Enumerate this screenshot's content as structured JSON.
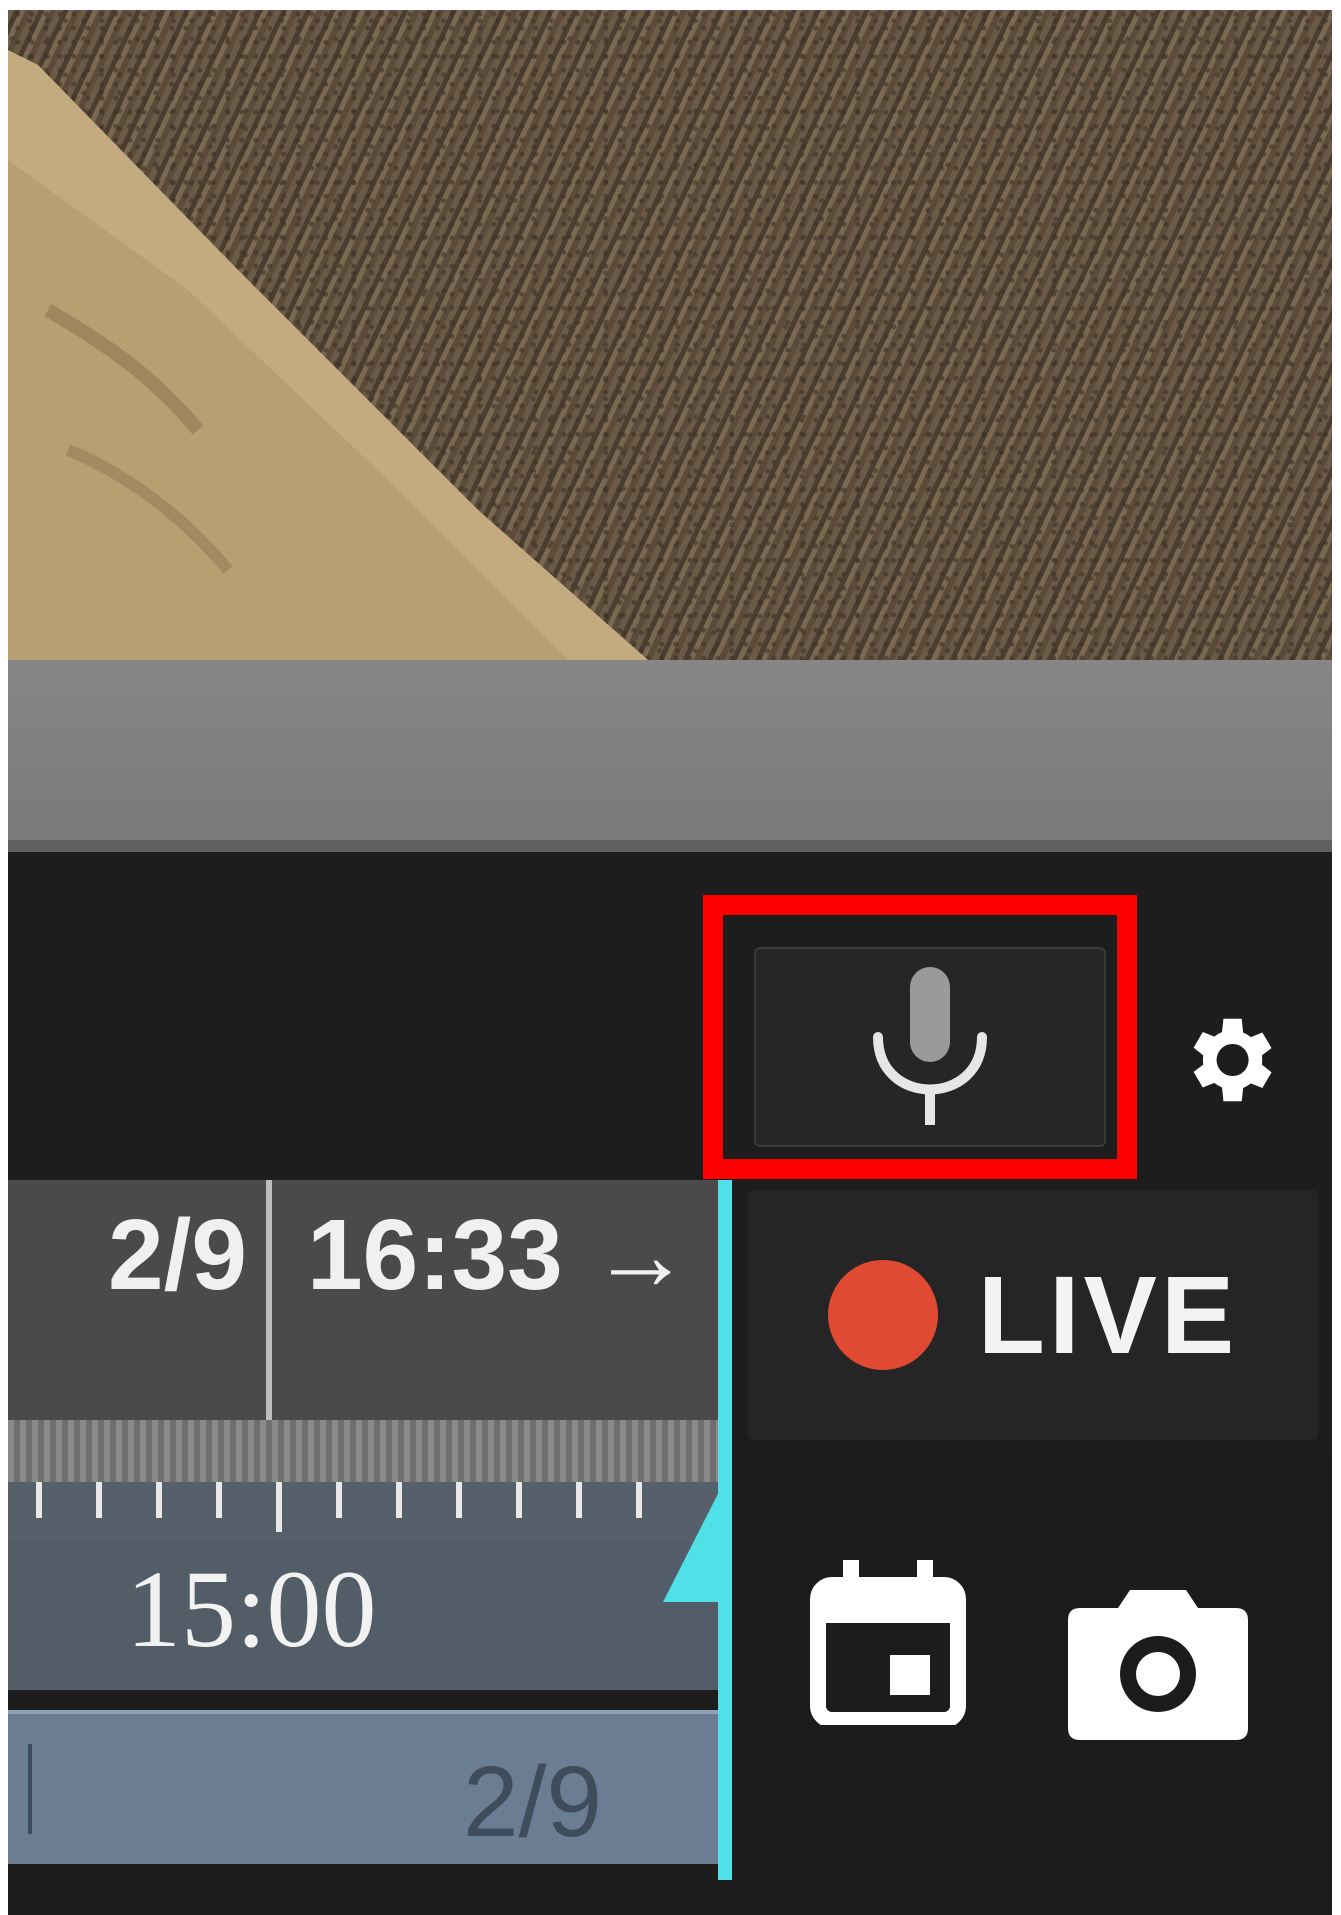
{
  "video": {
    "description_hidden": true
  },
  "toolbar": {
    "mic_button": "microphone-icon",
    "settings_button": "gear-icon"
  },
  "live": {
    "label": "LIVE",
    "dot_color": "#e04a33"
  },
  "timeline": {
    "date": "2/9",
    "time": "16:33",
    "arrow": "→",
    "hour_label": "15:00",
    "day_label": "2/9",
    "cursor_color": "#4fe0e8"
  },
  "actions": {
    "calendar_button": "calendar-icon",
    "snapshot_button": "camera-icon"
  },
  "highlight_color": "#ff0000"
}
